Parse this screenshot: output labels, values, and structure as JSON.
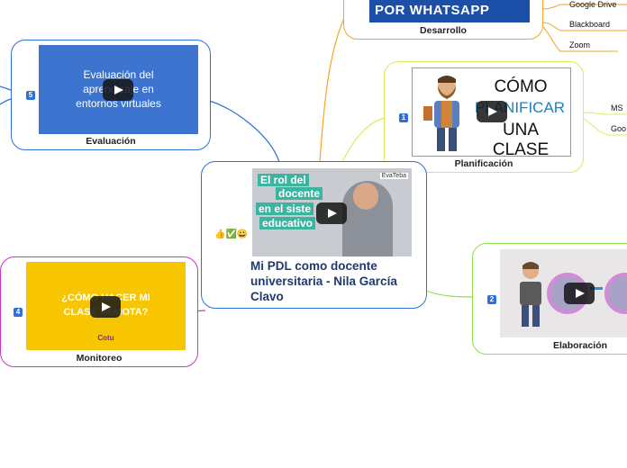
{
  "central": {
    "title": "Mi PDL como docente universitaria - Nila García Clavo",
    "emoji_prefix": "👍✅😀",
    "thumb_text": [
      "El rol del",
      "docente",
      "en el siste",
      "educativo"
    ],
    "thumb_logo": "EvaTeba"
  },
  "nodes": [
    {
      "id": "desarrollo",
      "label": "Desarrollo",
      "thumb_text": "POR WHATSAPP",
      "color": "#f5a623"
    },
    {
      "id": "evaluacion",
      "label": "Evaluación",
      "number": "5",
      "thumb_text": [
        "Evaluación del",
        "aprendizaje en",
        "entornos virtuales"
      ],
      "color": "#2f6fd8"
    },
    {
      "id": "planificacion",
      "label": "Planificación",
      "number": "1",
      "thumb_text": [
        "CÓMO",
        "PLANIFICAR",
        "UNA CLASE"
      ],
      "color": "#c8e04a"
    },
    {
      "id": "monitoreo",
      "label": "Monitoreo",
      "number": "4",
      "thumb_text": [
        "¿CÓMO HACER MI",
        "CLASE REMOTA?"
      ],
      "thumb_logo": "Cotu",
      "color": "#cc33cc"
    },
    {
      "id": "elaboracion",
      "label": "Elaboración",
      "number": "2",
      "color": "#8fe04a"
    }
  ],
  "desarrollo_leaves": [
    "Google Drive",
    "Blackboard",
    "Zoom"
  ],
  "planificacion_leaves": [
    "MS",
    "Goo"
  ],
  "colors": {
    "evaluacion": "#2f6fd8",
    "desarrollo": "#f5a623",
    "planificacion": "#c8e04a",
    "elaboracion": "#8fe04a",
    "monitoreo": "#cc33cc",
    "central": "#2f6fd8"
  }
}
